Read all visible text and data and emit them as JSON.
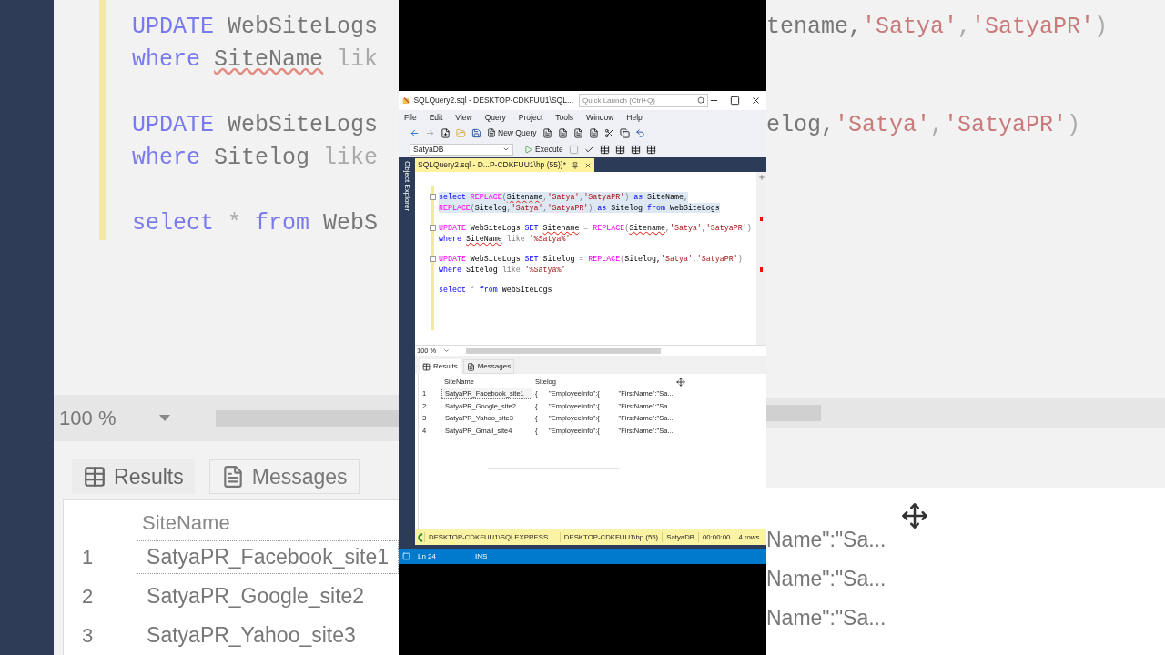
{
  "backdrop_left": {
    "code_lines": [
      [
        {
          "text": "UPDATE",
          "kind": "keyword"
        },
        {
          "text": " WebSiteLogs",
          "kind": "identifier"
        }
      ],
      [
        {
          "text": "where ",
          "kind": "keyword"
        },
        {
          "text": "SiteName",
          "kind": "misspelled"
        },
        {
          "text": " lik",
          "kind": "operator"
        }
      ],
      [
        {
          "text": "UPDATE",
          "kind": "keyword"
        },
        {
          "text": " WebSiteLogs",
          "kind": "identifier"
        }
      ],
      [
        {
          "text": "where",
          "kind": "keyword"
        },
        {
          "text": " Sitelog ",
          "kind": "identifier"
        },
        {
          "text": "like",
          "kind": "operator"
        }
      ],
      [
        {
          "text": "select",
          "kind": "keyword"
        },
        {
          "text": " * ",
          "kind": "operator"
        },
        {
          "text": "from",
          "kind": "keyword"
        },
        {
          "text": " WebS",
          "kind": "identifier"
        }
      ]
    ],
    "zoom": "100 %",
    "tabs": [
      {
        "label": "Results",
        "selected": true
      },
      {
        "label": "Messages",
        "selected": false
      }
    ],
    "column": "SiteName",
    "rows": [
      {
        "number": "1",
        "site_name": "SatyaPR_Facebook_site1",
        "selected": true
      },
      {
        "number": "2",
        "site_name": "SatyaPR_Google_site2",
        "selected": false
      },
      {
        "number": "3",
        "site_name": "SatyaPR_Yahoo_site3",
        "selected": false
      }
    ]
  },
  "backdrop_right": {
    "code_lines": [
      [
        {
          "text": "tename,",
          "kind": "identifier"
        },
        {
          "text": "'Satya'",
          "kind": "string"
        },
        {
          "text": ",",
          "kind": "operator"
        },
        {
          "text": "'SatyaPR'",
          "kind": "string"
        },
        {
          "text": ")",
          "kind": "operator"
        }
      ],
      [
        {
          "text": "elog,",
          "kind": "identifier"
        },
        {
          "text": "'Satya'",
          "kind": "string"
        },
        {
          "text": ",",
          "kind": "operator"
        },
        {
          "text": "'SatyaPR'",
          "kind": "string"
        },
        {
          "text": ")",
          "kind": "operator"
        }
      ]
    ],
    "cells": [
      "Name\":\"Sa...",
      "Name\":\"Sa...",
      "Name\":\"Sa..."
    ]
  },
  "window": {
    "title": "SQLQuery2.sql - DESKTOP-CDKFUU1\\SQL...",
    "quick_launch": {
      "placeholder": "Quick Launch (Ctrl+Q)"
    },
    "menu": [
      "File",
      "Edit",
      "View",
      "Query",
      "Project",
      "Tools",
      "Window",
      "Help"
    ],
    "new_query": "New Query",
    "database": "SatyaDB",
    "execute": "Execute",
    "side_panel": "Object Explorer",
    "tab": {
      "label": "SQLQuery2.sql - D...P-CDKFUU1\\hp (55))*",
      "selected": true
    },
    "statements": [
      [
        {
          "highlighted": true,
          "foldable": true,
          "tokens": [
            {
              "text": "select ",
              "kind": "keyword"
            },
            {
              "text": "REPLACE",
              "kind": "function"
            },
            {
              "text": "(",
              "kind": "operator"
            },
            {
              "text": "Sitename",
              "kind": "misspelled"
            },
            {
              "text": ",",
              "kind": "operator"
            },
            {
              "text": "'Satya'",
              "kind": "string"
            },
            {
              "text": ",",
              "kind": "operator"
            },
            {
              "text": "'SatyaPR'",
              "kind": "string"
            },
            {
              "text": ")",
              "kind": "operator"
            },
            {
              "text": " as",
              "kind": "keyword"
            },
            {
              "text": " SiteName",
              "kind": "identifier"
            },
            {
              "text": ",",
              "kind": "operator"
            }
          ]
        },
        {
          "highlighted": true,
          "foldable": false,
          "tokens": [
            {
              "text": "REPLACE",
              "kind": "function"
            },
            {
              "text": "(",
              "kind": "operator"
            },
            {
              "text": "Sitelog",
              "kind": "identifier"
            },
            {
              "text": ",",
              "kind": "operator"
            },
            {
              "text": "'Satya'",
              "kind": "string"
            },
            {
              "text": ",",
              "kind": "operator"
            },
            {
              "text": "'SatyaPR'",
              "kind": "string"
            },
            {
              "text": ")",
              "kind": "operator"
            },
            {
              "text": " as",
              "kind": "keyword"
            },
            {
              "text": " Sitelog ",
              "kind": "identifier"
            },
            {
              "text": "from",
              "kind": "keyword"
            },
            {
              "text": " WebSiteLogs",
              "kind": "identifier"
            }
          ]
        }
      ],
      [
        {
          "highlighted": false,
          "foldable": true,
          "tokens": [
            {
              "text": "UPDATE",
              "kind": "function"
            },
            {
              "text": " WebSiteLogs ",
              "kind": "identifier"
            },
            {
              "text": "SET ",
              "kind": "keyword"
            },
            {
              "text": "Sitename",
              "kind": "misspelled"
            },
            {
              "text": " = ",
              "kind": "operator"
            },
            {
              "text": "REPLACE",
              "kind": "function"
            },
            {
              "text": "(",
              "kind": "operator"
            },
            {
              "text": "Sitename",
              "kind": "misspelled"
            },
            {
              "text": ",",
              "kind": "operator"
            },
            {
              "text": "'Satya'",
              "kind": "string"
            },
            {
              "text": ",",
              "kind": "operator"
            },
            {
              "text": "'SatyaPR'",
              "kind": "string"
            },
            {
              "text": ")",
              "kind": "operator"
            }
          ]
        },
        {
          "highlighted": false,
          "foldable": false,
          "tokens": [
            {
              "text": "where ",
              "kind": "keyword"
            },
            {
              "text": "SiteName",
              "kind": "misspelled"
            },
            {
              "text": " like ",
              "kind": "operator"
            },
            {
              "text": "'%Satya%'",
              "kind": "string"
            }
          ]
        }
      ],
      [
        {
          "highlighted": false,
          "foldable": true,
          "tokens": [
            {
              "text": "UPDATE",
              "kind": "function"
            },
            {
              "text": " WebSiteLogs ",
              "kind": "identifier"
            },
            {
              "text": "SET",
              "kind": "keyword"
            },
            {
              "text": " Sitelog ",
              "kind": "identifier"
            },
            {
              "text": "= ",
              "kind": "operator"
            },
            {
              "text": "REPLACE",
              "kind": "function"
            },
            {
              "text": "(",
              "kind": "operator"
            },
            {
              "text": "Sitelog,",
              "kind": "identifier"
            },
            {
              "text": "'Satya'",
              "kind": "string"
            },
            {
              "text": ",",
              "kind": "operator"
            },
            {
              "text": "'SatyaPR'",
              "kind": "string"
            },
            {
              "text": ")",
              "kind": "operator"
            }
          ]
        },
        {
          "highlighted": false,
          "foldable": false,
          "tokens": [
            {
              "text": "where",
              "kind": "keyword"
            },
            {
              "text": " Sitelog ",
              "kind": "identifier"
            },
            {
              "text": "like ",
              "kind": "operator"
            },
            {
              "text": "'%Satya%'",
              "kind": "string"
            }
          ]
        }
      ],
      [
        {
          "highlighted": false,
          "foldable": false,
          "tokens": [
            {
              "text": "select",
              "kind": "keyword"
            },
            {
              "text": " * ",
              "kind": "operator"
            },
            {
              "text": "from",
              "kind": "keyword"
            },
            {
              "text": " WebSiteLogs",
              "kind": "identifier"
            }
          ]
        }
      ]
    ],
    "zoom": "100 %",
    "result_tabs": [
      {
        "label": "Results",
        "selected": true
      },
      {
        "label": "Messages",
        "selected": false
      }
    ],
    "columns": [
      "SiteName",
      "Sitelog"
    ],
    "rows": [
      {
        "number": "1",
        "site_name": "SatyaPR_Facebook_site1",
        "sitelog": "{      \"EmployeeInfo\":{          \"FirstName\":\"Sa...",
        "selected": true
      },
      {
        "number": "2",
        "site_name": "SatyaPR_Google_site2",
        "sitelog": "{      \"EmployeeInfo\":{          \"FirstName\":\"Sa...",
        "selected": false
      },
      {
        "number": "3",
        "site_name": "SatyaPR_Yahoo_site3",
        "sitelog": "{      \"EmployeeInfo\":{          \"FirstName\":\"Sa...",
        "selected": false
      },
      {
        "number": "4",
        "site_name": "SatyaPR_Gmail_site4",
        "sitelog": "{      \"EmployeeInfo\":{          \"FirstName\":\"Sa...",
        "selected": false
      }
    ],
    "query_status": [
      "DESKTOP-CDKFUU1\\SQLEXPRESS ...",
      "DESKTOP-CDKFUU1\\hp (55)",
      "SatyaDB",
      "00:00:00",
      "4 rows"
    ],
    "status_bar": {
      "line": "Ln 24",
      "mode": "INS"
    }
  }
}
